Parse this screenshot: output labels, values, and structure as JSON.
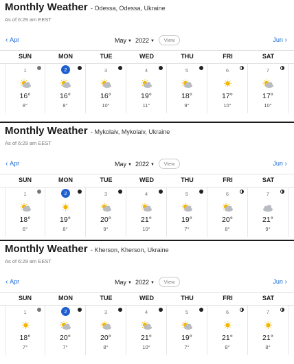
{
  "sections": [
    {
      "title": "Monthly Weather",
      "location": "- Odessa, Odessa, Ukraine",
      "as_of": "As of 6:29 am EEST",
      "prev": "Apr",
      "next": "Jun",
      "month": "May",
      "year": "2022",
      "view": "View",
      "days": [
        {
          "num": "1",
          "hi": "16°",
          "lo": "8°",
          "icon": "partly-cloudy-icon",
          "moon": "grey"
        },
        {
          "num": "2",
          "hi": "16°",
          "lo": "8°",
          "icon": "partly-cloudy-icon",
          "moon": "new",
          "today": true
        },
        {
          "num": "3",
          "hi": "16°",
          "lo": "10°",
          "icon": "partly-cloudy-icon",
          "moon": "new"
        },
        {
          "num": "4",
          "hi": "19°",
          "lo": "11°",
          "icon": "partly-cloudy-icon",
          "moon": "new"
        },
        {
          "num": "5",
          "hi": "18°",
          "lo": "9°",
          "icon": "partly-cloudy-icon",
          "moon": "new"
        },
        {
          "num": "6",
          "hi": "17°",
          "lo": "10°",
          "icon": "sunny-icon",
          "moon": "half"
        },
        {
          "num": "7",
          "hi": "17°",
          "lo": "10°",
          "icon": "partly-cloudy-icon",
          "moon": "half"
        }
      ]
    },
    {
      "title": "Monthly Weather",
      "location": "- Mykolaiv, Mykolaiv, Ukraine",
      "as_of": "As of 6:29 am EEST",
      "prev": "Apr",
      "next": "Jun",
      "month": "May",
      "year": "2022",
      "view": "View",
      "days": [
        {
          "num": "1",
          "hi": "18°",
          "lo": "6°",
          "icon": "partly-cloudy-icon",
          "moon": "grey"
        },
        {
          "num": "2",
          "hi": "19°",
          "lo": "8°",
          "icon": "sunny-icon",
          "moon": "new",
          "today": true
        },
        {
          "num": "3",
          "hi": "20°",
          "lo": "9°",
          "icon": "partly-cloudy-icon",
          "moon": "new"
        },
        {
          "num": "4",
          "hi": "21°",
          "lo": "10°",
          "icon": "partly-cloudy-icon",
          "moon": "new"
        },
        {
          "num": "5",
          "hi": "19°",
          "lo": "7°",
          "icon": "partly-cloudy-icon",
          "moon": "new"
        },
        {
          "num": "6",
          "hi": "20°",
          "lo": "8°",
          "icon": "partly-cloudy-icon",
          "moon": "half"
        },
        {
          "num": "7",
          "hi": "21°",
          "lo": "9°",
          "icon": "cloudy-icon",
          "moon": "half"
        }
      ]
    },
    {
      "title": "Monthly Weather",
      "location": "- Kherson, Kherson, Ukraine",
      "as_of": "As of 6:29 am EEST",
      "prev": "Apr",
      "next": "Jun",
      "month": "May",
      "year": "2022",
      "view": "View",
      "days": [
        {
          "num": "1",
          "hi": "18°",
          "lo": "7°",
          "icon": "sunny-icon",
          "moon": "grey"
        },
        {
          "num": "2",
          "hi": "20°",
          "lo": "7°",
          "icon": "partly-cloudy-icon",
          "moon": "new",
          "today": true
        },
        {
          "num": "3",
          "hi": "20°",
          "lo": "8°",
          "icon": "partly-cloudy-icon",
          "moon": "new"
        },
        {
          "num": "4",
          "hi": "21°",
          "lo": "10°",
          "icon": "partly-cloudy-icon",
          "moon": "new"
        },
        {
          "num": "5",
          "hi": "19°",
          "lo": "7°",
          "icon": "partly-cloudy-icon",
          "moon": "new"
        },
        {
          "num": "6",
          "hi": "21°",
          "lo": "8°",
          "icon": "sunny-icon",
          "moon": "half"
        },
        {
          "num": "7",
          "hi": "21°",
          "lo": "8°",
          "icon": "sunny-icon",
          "moon": "half"
        }
      ]
    }
  ],
  "weekdays": [
    "SUN",
    "MON",
    "TUE",
    "WED",
    "THU",
    "FRI",
    "SAT"
  ],
  "colors": {
    "link": "#1a6bd6",
    "today": "#1f5fcf",
    "sun": "#f2b705",
    "cloud": "#b9bcc2"
  }
}
